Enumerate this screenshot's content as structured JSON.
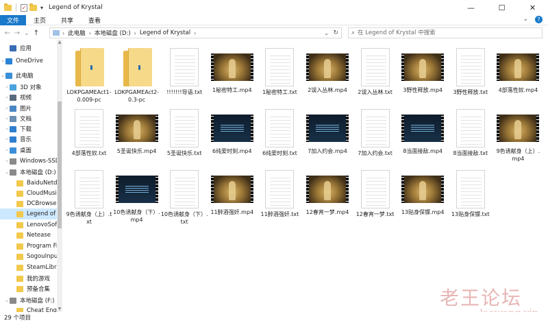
{
  "window": {
    "title": "Legend of Krystal",
    "controls": [
      "—",
      "☐",
      "✕"
    ]
  },
  "ribbon": {
    "tabs": [
      "文件",
      "主页",
      "共享",
      "查看"
    ]
  },
  "address": {
    "crumbs": [
      "此电脑",
      "本地磁盘 (D:)",
      "Legend of Krystal"
    ],
    "search_placeholder": "在 Legend of Krystal 中搜索"
  },
  "sidebar": {
    "items": [
      {
        "label": "应用",
        "color": "#3b6cb7"
      },
      {
        "label": "OneDrive",
        "color": "#2b83d6"
      },
      {
        "label": "此电脑",
        "color": "#3a8fd8"
      },
      {
        "label": "3D 对象",
        "color": "#4aa3df"
      },
      {
        "label": "视频",
        "color": "#5a6a7d"
      },
      {
        "label": "图片",
        "color": "#4b87c4"
      },
      {
        "label": "文档",
        "color": "#6b8fb5"
      },
      {
        "label": "下载",
        "color": "#2f7fcf"
      },
      {
        "label": "音乐",
        "color": "#2f7fcf"
      },
      {
        "label": "桌面",
        "color": "#3a8fd8"
      },
      {
        "label": "Windows-SSD",
        "color": "#8a8a8a"
      },
      {
        "label": "本地磁盘 (D:)",
        "color": "#8a8a8a"
      },
      {
        "label": "BaiduNetdisk",
        "color": "#f2c94c"
      },
      {
        "label": "CloudMusic",
        "color": "#f2c94c"
      },
      {
        "label": "DCBrowser",
        "color": "#f2c94c"
      },
      {
        "label": "Legend of Krystal",
        "color": "#f2c94c"
      },
      {
        "label": "LenovoSoftstore",
        "color": "#f2c94c"
      },
      {
        "label": "Netease",
        "color": "#f2c94c"
      },
      {
        "label": "Program Files",
        "color": "#f2c94c"
      },
      {
        "label": "SogouInput",
        "color": "#f2c94c"
      },
      {
        "label": "SteamLibrary",
        "color": "#f2c94c"
      },
      {
        "label": "我的游戏",
        "color": "#f2c94c"
      },
      {
        "label": "预备合集",
        "color": "#f2c94c"
      },
      {
        "label": "本地磁盘 (F:)",
        "color": "#8a8a8a"
      },
      {
        "label": "Cheat Engine",
        "color": "#f2c94c"
      }
    ]
  },
  "files": [
    {
      "name": "LOKPGAMEAct1-0.009-pc",
      "kind": "folder"
    },
    {
      "name": "LOKPGAMEAct2-0.3-pc",
      "kind": "folder"
    },
    {
      "name": "!!!!!!!导语.txt",
      "kind": "txt"
    },
    {
      "name": "1秘密特工.mp4",
      "kind": "video",
      "tone": "gold"
    },
    {
      "name": "1秘密特工.txt",
      "kind": "txt"
    },
    {
      "name": "2误入丛林.mp4",
      "kind": "video",
      "tone": "gold"
    },
    {
      "name": "2误入丛林.txt",
      "kind": "txt"
    },
    {
      "name": "3野性释放.mp4",
      "kind": "video",
      "tone": "gold"
    },
    {
      "name": "3野性释放.txt",
      "kind": "txt"
    },
    {
      "name": "4部落性奴.mp4",
      "kind": "video",
      "tone": "gold"
    },
    {
      "name": "4部落性奴.txt",
      "kind": "txt"
    },
    {
      "name": "5圣诞快乐.mp4",
      "kind": "video",
      "tone": "gold"
    },
    {
      "name": "5圣诞快乐.txt",
      "kind": "txt"
    },
    {
      "name": "6纯爱时刻.mp4",
      "kind": "video",
      "tone": "dark"
    },
    {
      "name": "6纯爱时刻.txt",
      "kind": "txt"
    },
    {
      "name": "7加入约会.mp4",
      "kind": "video",
      "tone": "dark"
    },
    {
      "name": "7加入约会.txt",
      "kind": "txt"
    },
    {
      "name": "8当面接敌.mp4",
      "kind": "video",
      "tone": "dark"
    },
    {
      "name": "8当面接敌.txt",
      "kind": "txt"
    },
    {
      "name": "9色诱献身（上）.mp4",
      "kind": "video",
      "tone": "gold"
    },
    {
      "name": "9色诱献身（上）.txt",
      "kind": "txt"
    },
    {
      "name": "10色诱献身（下）.mp4",
      "kind": "video",
      "tone": "dark"
    },
    {
      "name": "10色诱献身（下）.txt",
      "kind": "txt"
    },
    {
      "name": "11醉酒强奸.mp4",
      "kind": "video",
      "tone": "gold"
    },
    {
      "name": "11醉酒强奸.txt",
      "kind": "txt"
    },
    {
      "name": "12春宵一梦.mp4",
      "kind": "video",
      "tone": "gold"
    },
    {
      "name": "12春宵一梦.txt",
      "kind": "txt"
    },
    {
      "name": "13贴身保镖.mp4",
      "kind": "video",
      "tone": "gold"
    },
    {
      "name": "13贴身保镖.txt",
      "kind": "txt"
    }
  ],
  "status": {
    "count": "29 个项目"
  },
  "watermark": {
    "cn": "老王论坛",
    "en": "laowang.vip"
  }
}
